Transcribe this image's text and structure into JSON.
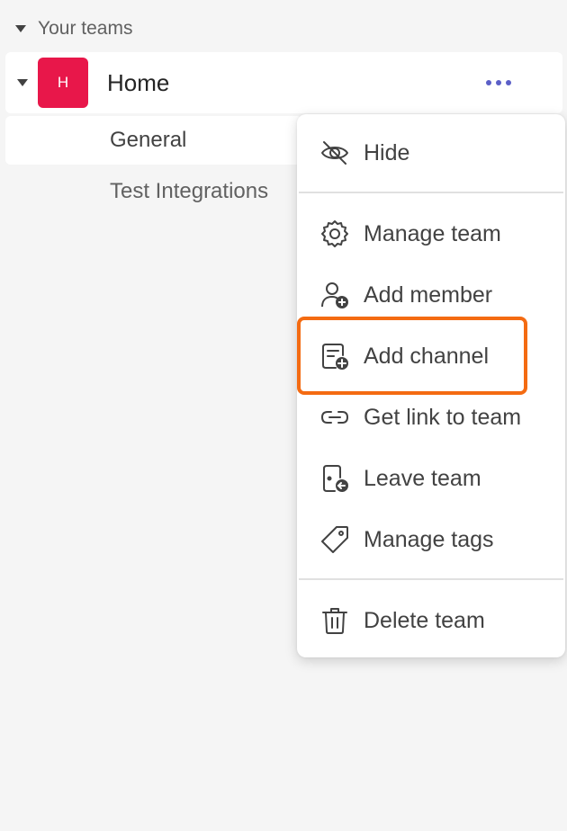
{
  "sidebar": {
    "section_title": "Your teams",
    "team": {
      "name": "Home",
      "avatar_initial": "H",
      "avatar_color": "#e8174a"
    },
    "channels": [
      {
        "name": "General",
        "selected": true
      },
      {
        "name": "Test Integrations",
        "selected": false
      }
    ]
  },
  "context_menu": {
    "items": [
      {
        "label": "Hide",
        "icon": "hide-icon"
      },
      {
        "label": "Manage team",
        "icon": "gear-icon"
      },
      {
        "label": "Add member",
        "icon": "add-person-icon"
      },
      {
        "label": "Add channel",
        "icon": "add-channel-icon"
      },
      {
        "label": "Get link to team",
        "icon": "link-icon"
      },
      {
        "label": "Leave team",
        "icon": "leave-icon"
      },
      {
        "label": "Manage tags",
        "icon": "tag-icon"
      },
      {
        "label": "Delete team",
        "icon": "trash-icon"
      }
    ],
    "highlighted_item": "Add channel"
  },
  "colors": {
    "accent": "#5b5fc7",
    "highlight": "#f46b12"
  }
}
